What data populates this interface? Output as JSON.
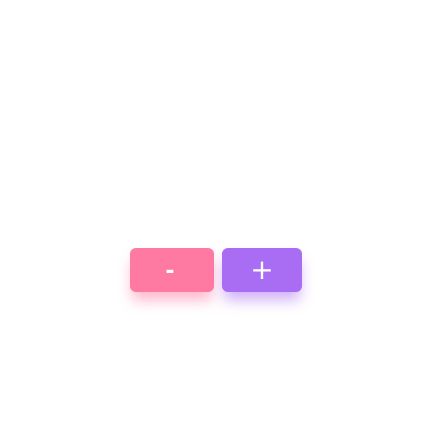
{
  "stepper": {
    "minus_label": "-",
    "plus_label": "+",
    "minus_color": "#ff7aa2",
    "plus_color": "#a96df3"
  }
}
